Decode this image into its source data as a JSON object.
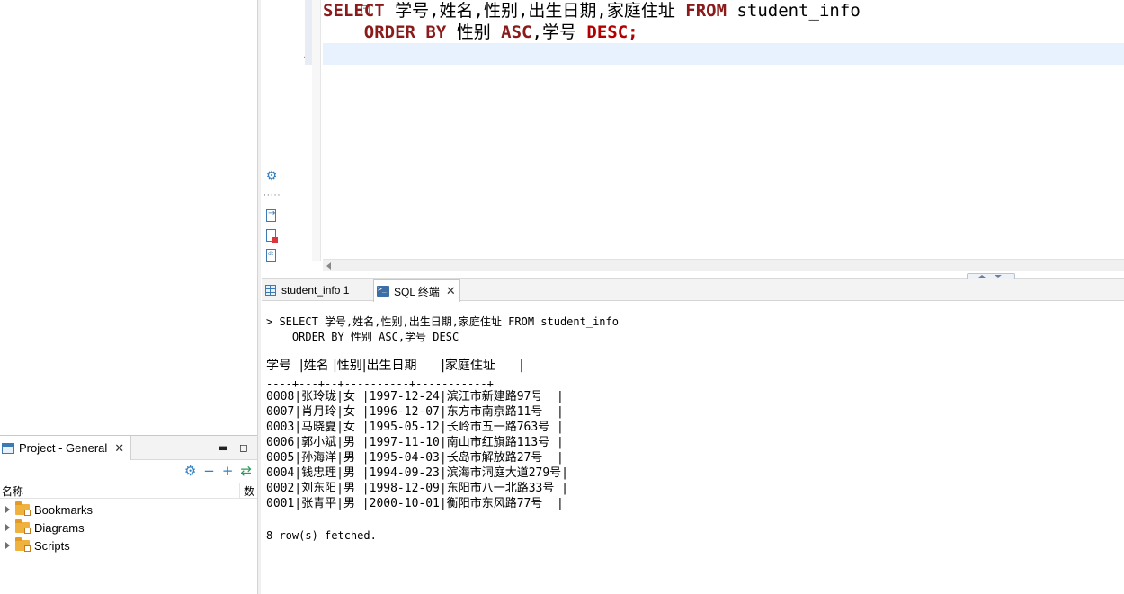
{
  "project_panel": {
    "tab_title": "Project - General",
    "close_glyph": "✕",
    "minimize_glyph": "▬",
    "maximize_glyph": "◻",
    "col_name": "名称",
    "col_count": "数",
    "items": [
      {
        "label": "Bookmarks",
        "icon": "bookmarks-folder-icon"
      },
      {
        "label": "Diagrams",
        "icon": "diagrams-folder-icon"
      },
      {
        "label": "Scripts",
        "icon": "scripts-folder-icon"
      }
    ]
  },
  "editor": {
    "line1": {
      "kw_select": "SELECT",
      "columns": " 学号,姓名,性别,出生日期,家庭住址 ",
      "kw_from": "FROM",
      "table": " student_info"
    },
    "line2": {
      "indent": "    ",
      "kw_order_by": "ORDER BY",
      "col1": " 性别 ",
      "kw_asc": "ASC",
      "col2": ",学号 ",
      "kw_desc": "DESC;"
    }
  },
  "result_tabs": {
    "tab1": "student_info 1",
    "tab2": "SQL 终端",
    "tab2_close": "✕"
  },
  "terminal": {
    "query_line1": "> SELECT 学号,姓名,性别,出生日期,家庭住址 FROM student_info",
    "query_line2": "    ORDER BY 性别 ASC,学号 DESC",
    "header": "学号  |姓名 |性别|出生日期      |家庭住址      |",
    "separator": "----+---+--+----------+-----------+",
    "rows": [
      "0008|张玲珑|女 |1997-12-24|滨江市新建路97号  |",
      "0007|肖月玲|女 |1996-12-07|东方市南京路11号  |",
      "0003|马晓夏|女 |1995-05-12|长岭市五一路763号 |",
      "0006|郭小斌|男 |1997-11-10|南山市红旗路113号 |",
      "0005|孙海洋|男 |1995-04-03|长岛市解放路27号  |",
      "0004|钱忠理|男 |1994-09-23|滨海市洞庭大道279号|",
      "0002|刘东阳|男 |1998-12-09|东阳市八一北路33号 |",
      "0001|张青平|男 |2000-10-01|衡阳市东风路77号  |"
    ],
    "footer": "8 row(s) fetched."
  }
}
